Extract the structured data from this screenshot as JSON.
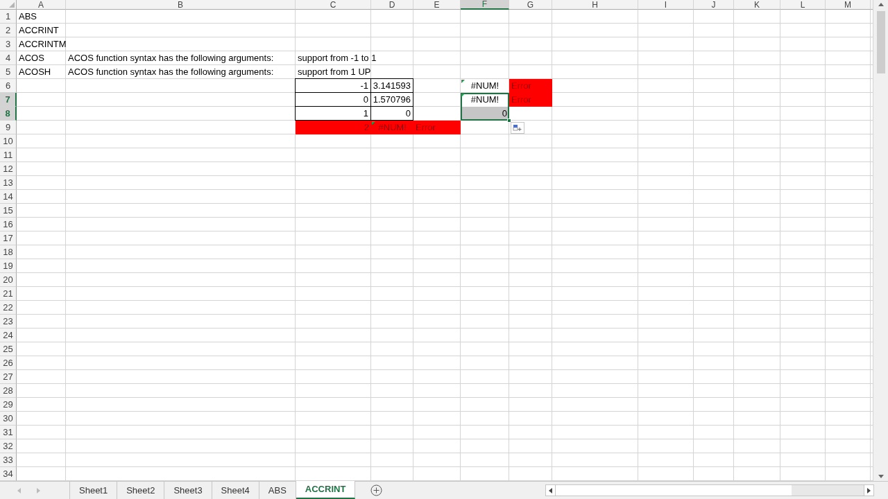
{
  "columns": [
    {
      "label": "A",
      "selected": false
    },
    {
      "label": "B",
      "selected": false
    },
    {
      "label": "C",
      "selected": false
    },
    {
      "label": "D",
      "selected": false
    },
    {
      "label": "E",
      "selected": false
    },
    {
      "label": "F",
      "selected": true
    },
    {
      "label": "G",
      "selected": false
    },
    {
      "label": "H",
      "selected": false
    },
    {
      "label": "I",
      "selected": false
    },
    {
      "label": "J",
      "selected": false
    },
    {
      "label": "K",
      "selected": false
    },
    {
      "label": "L",
      "selected": false
    },
    {
      "label": "M",
      "selected": false
    }
  ],
  "rows": [
    {
      "number": "1",
      "selected": false,
      "cells": {
        "A": {
          "kind": "text",
          "text": "ABS"
        }
      }
    },
    {
      "number": "2",
      "selected": false,
      "cells": {
        "A": {
          "kind": "text",
          "text": "ACCRINT"
        }
      }
    },
    {
      "number": "3",
      "selected": false,
      "cells": {
        "A": {
          "kind": "text",
          "text": "ACCRINTM"
        }
      }
    },
    {
      "number": "4",
      "selected": false,
      "cells": {
        "A": {
          "kind": "text",
          "text": "ACOS"
        },
        "B": {
          "kind": "text",
          "text": "ACOS function syntax has the following arguments:"
        },
        "C": {
          "kind": "text",
          "text": "support from -1 to 1"
        }
      }
    },
    {
      "number": "5",
      "selected": false,
      "cells": {
        "A": {
          "kind": "text",
          "text": "ACOSH"
        },
        "B": {
          "kind": "text",
          "text": "ACOS function syntax has the following arguments:"
        },
        "C": {
          "kind": "text",
          "text": "support from 1 UP"
        }
      }
    },
    {
      "number": "6",
      "selected": false,
      "cells": {
        "C": {
          "kind": "number",
          "text": "-1",
          "bordered": true
        },
        "D": {
          "kind": "number",
          "text": "3.141593",
          "bordered": true
        },
        "F": {
          "kind": "error",
          "text": "#NUM!",
          "flagged": true
        },
        "G": {
          "kind": "text",
          "text": "Error",
          "highlight": true
        }
      }
    },
    {
      "number": "7",
      "selected": true,
      "cells": {
        "C": {
          "kind": "number",
          "text": "0",
          "bordered": true
        },
        "D": {
          "kind": "number",
          "text": "1.570796",
          "bordered": true
        },
        "F": {
          "kind": "error",
          "text": "#NUM!",
          "flagged": true,
          "selected": true,
          "active": true
        },
        "G": {
          "kind": "text",
          "text": "Error",
          "highlight": true
        }
      }
    },
    {
      "number": "8",
      "selected": true,
      "cells": {
        "C": {
          "kind": "number",
          "text": "1",
          "bordered": true
        },
        "D": {
          "kind": "number",
          "text": "0",
          "bordered": true
        },
        "F": {
          "kind": "number",
          "text": "0",
          "selected": true,
          "active": false
        }
      }
    },
    {
      "number": "9",
      "selected": false,
      "cells": {
        "C": {
          "kind": "number",
          "text": "2",
          "highlight": true
        },
        "D": {
          "kind": "error",
          "text": "#NUM!",
          "highlight": true,
          "flagged": true
        },
        "E": {
          "kind": "text",
          "text": "Error",
          "highlight": true
        }
      }
    },
    {
      "number": "10",
      "selected": false
    },
    {
      "number": "11",
      "selected": false
    },
    {
      "number": "12",
      "selected": false
    },
    {
      "number": "13",
      "selected": false
    },
    {
      "number": "14",
      "selected": false
    },
    {
      "number": "15",
      "selected": false
    },
    {
      "number": "16",
      "selected": false
    },
    {
      "number": "17",
      "selected": false
    },
    {
      "number": "18",
      "selected": false
    },
    {
      "number": "19",
      "selected": false
    },
    {
      "number": "20",
      "selected": false
    },
    {
      "number": "21",
      "selected": false
    },
    {
      "number": "22",
      "selected": false
    },
    {
      "number": "23",
      "selected": false
    },
    {
      "number": "24",
      "selected": false
    },
    {
      "number": "25",
      "selected": false
    },
    {
      "number": "26",
      "selected": false
    },
    {
      "number": "27",
      "selected": false
    },
    {
      "number": "28",
      "selected": false
    },
    {
      "number": "29",
      "selected": false
    },
    {
      "number": "30",
      "selected": false
    },
    {
      "number": "31",
      "selected": false
    },
    {
      "number": "32",
      "selected": false
    },
    {
      "number": "33",
      "selected": false
    },
    {
      "number": "34",
      "selected": false
    }
  ],
  "sheet_tabs": [
    {
      "label": "Sheet1",
      "selected": false
    },
    {
      "label": "Sheet2",
      "selected": false
    },
    {
      "label": "Sheet3",
      "selected": false
    },
    {
      "label": "Sheet4",
      "selected": false
    },
    {
      "label": "ABS",
      "selected": false
    },
    {
      "label": "ACCRINT",
      "selected": true
    }
  ]
}
